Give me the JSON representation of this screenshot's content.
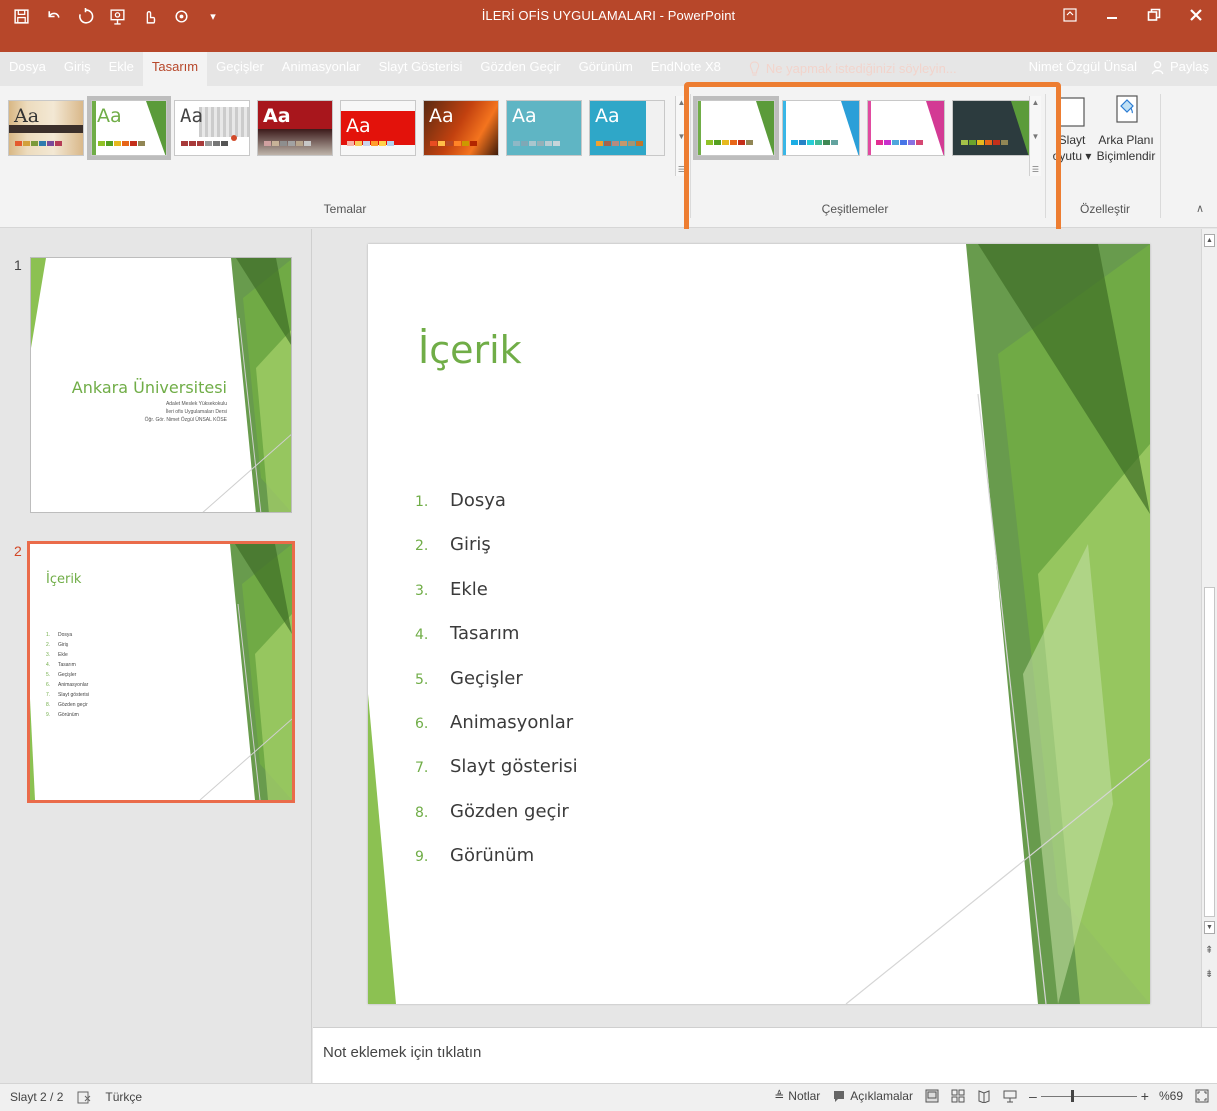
{
  "window": {
    "title": "İLERİ OFİS UYGULAMALARI - PowerPoint",
    "user": "Nimet Özgül Ünsal",
    "share": "Paylaş"
  },
  "tabs": [
    "Dosya",
    "Giriş",
    "Ekle",
    "Tasarım",
    "Geçişler",
    "Animasyonlar",
    "Slayt Gösterisi",
    "Gözden Geçir",
    "Görünüm",
    "EndNote X8"
  ],
  "active_tab": "Tasarım",
  "tell_me": "Ne yapmak istediğinizi söyleyin...",
  "ribbon": {
    "themes_label": "Temalar",
    "variants_label": "Çeşitlemeler",
    "customize_label": "Özelleştir",
    "slide_size_line1": "Slayt",
    "slide_size_line2": "oyutu ▾",
    "format_bg_line1": "Arka Planı",
    "format_bg_line2": "Biçimlendir",
    "theme_thumb_text": "Aa"
  },
  "slides": [
    {
      "number": "1",
      "title": "Ankara Üniversitesi",
      "subtitle_lines": [
        "Adalet Meslek Yüksekokulu",
        "İleri ofis Uygulamaları Dersi",
        "Öğr. Gör. Nimet Özgül ÜNSAL KÖSE"
      ]
    },
    {
      "number": "2",
      "title": "İçerik",
      "items": [
        "Dosya",
        "Giriş",
        "Ekle",
        "Tasarım",
        "Geçişler",
        "Animasyonlar",
        "Slayt gösterisi",
        "Gözden geçir",
        "Görünüm"
      ]
    }
  ],
  "main_slide": {
    "title": "İçerik",
    "items": [
      {
        "num": "1.",
        "text": "Dosya"
      },
      {
        "num": "2.",
        "text": "Giriş"
      },
      {
        "num": "3.",
        "text": "Ekle"
      },
      {
        "num": "4.",
        "text": "Tasarım"
      },
      {
        "num": "5.",
        "text": "Geçişler"
      },
      {
        "num": "6.",
        "text": "Animasyonlar"
      },
      {
        "num": "7.",
        "text": "Slayt gösterisi"
      },
      {
        "num": "8.",
        "text": "Gözden geçir"
      },
      {
        "num": "9.",
        "text": "Görünüm"
      }
    ]
  },
  "notes_placeholder": "Not eklemek için tıklatın",
  "status": {
    "slide": "Slayt 2 / 2",
    "language": "Türkçe",
    "notes": "Notlar",
    "comments": "Açıklamalar",
    "zoom": "%69",
    "zoom_level": 0.69
  },
  "colors": {
    "titlebar": "#b7472a",
    "accent_green": "#70ad47",
    "highlight_orange": "#ed7d31"
  }
}
